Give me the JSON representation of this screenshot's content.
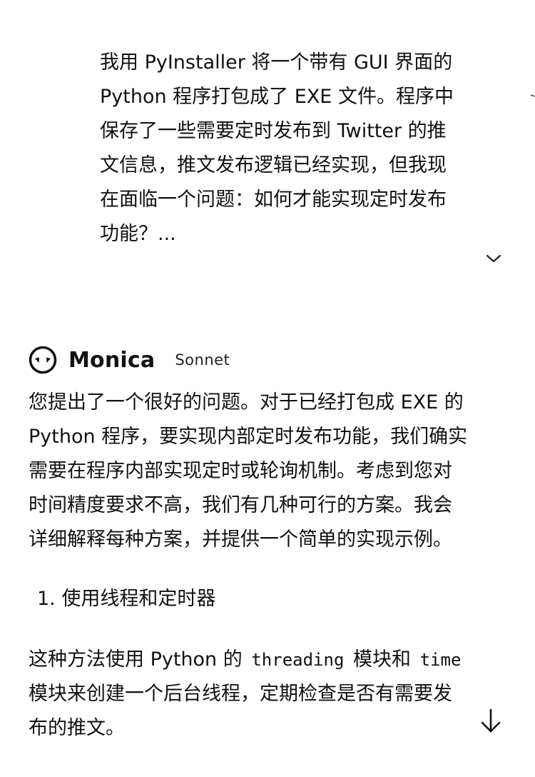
{
  "user_message": {
    "text": "我用 PyInstaller 将一个带有 GUI 界面的\nPython 程序打包成了 EXE 文件。程序中\n保存了一些需要定时发布到 Twitter 的推\n文信息，推文发布逻辑已经实现，但我现\n在面临一个问题：如何才能实现定时发布\n功能？...",
    "expand_icon": "chevron-down-icon"
  },
  "assistant": {
    "name": "Monica",
    "model": "Sonnet",
    "avatar_icon": "monica-avatar-icon"
  },
  "answer": {
    "intro": "您提出了一个很好的问题。对于已经打包成 EXE 的\nPython 程序，要实现内部定时发布功能，我们确实\n需要在程序内部实现定时或轮询机制。考虑到您对\n时间精度要求不高，我们有几种可行的方案。我会\n详细解释每种方案，并提供一个简单的实现示例。",
    "section_1_heading": "1. 使用线程和定时器",
    "section_1_line1_prefix": "这种方法使用 Python 的",
    "code_threading": "threading",
    "section_1_line1_mid": "模块和",
    "code_time": "time",
    "section_1_line2": "模块来创建一个后台线程，定期检查是否有需要发",
    "section_1_line3": "布的推文。"
  },
  "scroll_button": {
    "icon": "arrow-down-icon"
  }
}
